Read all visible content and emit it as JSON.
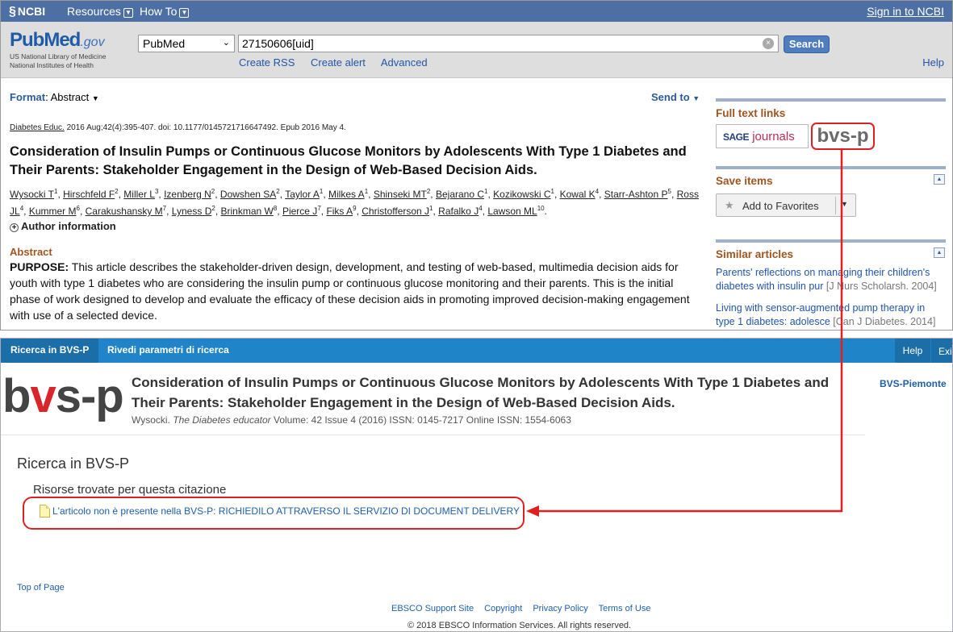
{
  "ncbi": {
    "logo": "NCBI",
    "resources": "Resources",
    "howto": "How To",
    "signin": "Sign in to NCBI"
  },
  "pubmed": {
    "logo_main": "PubMed",
    "logo_gov": ".gov",
    "logo_sub1": "US National Library of Medicine",
    "logo_sub2": "National Institutes of Health",
    "db_selected": "PubMed",
    "search_value": "27150606[uid]",
    "search_button": "Search",
    "links": [
      "Create RSS",
      "Create alert",
      "Advanced"
    ],
    "help": "Help",
    "format_label": "Format",
    "format_value": "Abstract",
    "send_to": "Send to",
    "citation_journal": "Diabetes Educ.",
    "citation_rest": " 2016 Aug;42(4):395-407. doi: 10.1177/0145721716647492. Epub 2016 May 4.",
    "title": "Consideration of Insulin Pumps or Continuous Glucose Monitors by Adolescents With Type 1 Diabetes and Their Parents: Stakeholder Engagement in the Design of Web-Based Decision Aids.",
    "authors": [
      {
        "name": "Wysocki T",
        "sup": "1"
      },
      {
        "name": "Hirschfeld F",
        "sup": "2"
      },
      {
        "name": "Miller L",
        "sup": "3"
      },
      {
        "name": "Izenberg N",
        "sup": "2"
      },
      {
        "name": "Dowshen SA",
        "sup": "2"
      },
      {
        "name": "Taylor A",
        "sup": "1"
      },
      {
        "name": "Milkes A",
        "sup": "1"
      },
      {
        "name": "Shinseki MT",
        "sup": "2"
      },
      {
        "name": "Bejarano C",
        "sup": "1"
      },
      {
        "name": "Kozikowski C",
        "sup": "1"
      },
      {
        "name": "Kowal K",
        "sup": "4"
      },
      {
        "name": "Starr-Ashton P",
        "sup": "5"
      },
      {
        "name": "Ross JL",
        "sup": "4"
      },
      {
        "name": "Kummer M",
        "sup": "6"
      },
      {
        "name": "Carakushansky M",
        "sup": "7"
      },
      {
        "name": "Lyness D",
        "sup": "2"
      },
      {
        "name": "Brinkman W",
        "sup": "8"
      },
      {
        "name": "Pierce J",
        "sup": "7"
      },
      {
        "name": "Fiks A",
        "sup": "9"
      },
      {
        "name": "Christofferson J",
        "sup": "1"
      },
      {
        "name": "Rafalko J",
        "sup": "4"
      },
      {
        "name": "Lawson ML",
        "sup": "10"
      }
    ],
    "author_info": "Author information",
    "abstract_head": "Abstract",
    "abstract_label": "PURPOSE:",
    "abstract_text": " This article describes the stakeholder-driven design, development, and testing of web-based, multimedia decision aids for youth with type 1 diabetes who are considering the insulin pump or continuous glucose monitoring and their parents. This is the initial phase of work designed to develop and evaluate the efficacy of these decision aids in promoting improved decision-making engagement with use of a selected device.",
    "full_text_head": "Full text links",
    "sage_brand": "SAGE",
    "sage_journals": "journals",
    "bvs_badge": "bvs-p",
    "save_head": "Save items",
    "add_favorites": "Add to Favorites",
    "similar_head": "Similar articles",
    "similar": [
      {
        "title": "Parents' reflections on managing their children's diabetes with insulin pur",
        "src": "[J Nurs Scholarsh. 2004]"
      },
      {
        "title": "Living with sensor-augmented pump therapy in type 1 diabetes: adolesce",
        "src": "[Can J Diabetes. 2014]"
      }
    ]
  },
  "bvs": {
    "tab_ricerca": "Ricerca in BVS-P",
    "tab_rivedi": "Rivedi parametri di ricerca",
    "help": "Help",
    "exit": "Exi",
    "logo_b": "b",
    "logo_v": "v",
    "logo_rest": "s-p",
    "title": "Consideration of Insulin Pumps or Continuous Glucose Monitors by Adolescents With Type 1 Diabetes and Their Parents: Stakeholder Engagement in the Design of Web-Based Decision Aids.",
    "cite_author": "Wysocki. ",
    "cite_journal": "The Diabetes educator",
    "cite_rest": " Volume: 42 Issue 4 (2016) ISSN: 0145-7217 Online ISSN: 1554-6063",
    "piemonte": "BVS-Piemonte",
    "heading": "Ricerca in BVS-P",
    "subheading": "Risorse trovate per questa citazione",
    "doc_link": "L'articolo non è presente nella BVS-P: RICHIEDILO ATTRAVERSO IL SERVIZIO DI DOCUMENT DELIVERY",
    "top_of_page": "Top of Page",
    "footer_links": [
      "EBSCO Support Site",
      "Copyright",
      "Privacy Policy",
      "Terms of Use"
    ],
    "copyright": "© 2018 EBSCO Information Services. All rights reserved."
  },
  "colors": {
    "ncbi_bar": "#4d6fa3",
    "bvs_bar": "#2084c8",
    "annotation_red": "#e02020",
    "section_head": "#a0541f"
  }
}
